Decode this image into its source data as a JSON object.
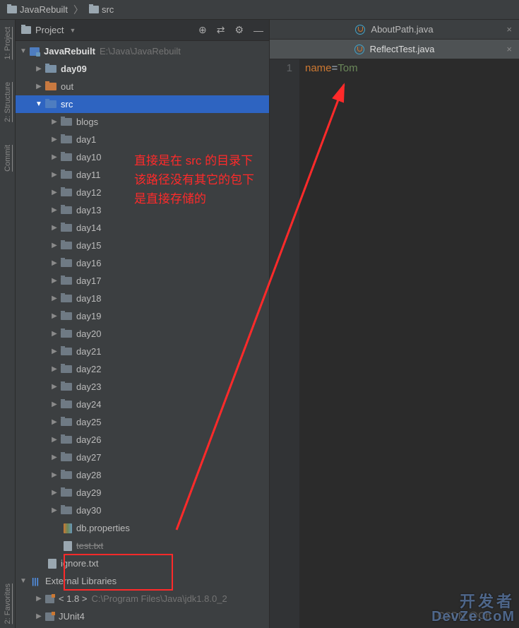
{
  "breadcrumb": {
    "items": [
      "JavaRebuilt",
      "src"
    ]
  },
  "panel": {
    "title": "Project",
    "actions": {
      "target": "⊕",
      "split": "⇄",
      "gear": "⚙",
      "hide": "—"
    }
  },
  "project": {
    "name": "JavaRebuilt",
    "path": "E:\\Java\\JavaRebuilt"
  },
  "tree": {
    "top": [
      {
        "label": "day09",
        "icon": "folder-blue",
        "indent": 2,
        "arrow": "right",
        "bold": true
      },
      {
        "label": "out",
        "icon": "folder-orange",
        "indent": 2,
        "arrow": "right"
      }
    ],
    "src": {
      "label": "src"
    },
    "dirs": [
      "blogs",
      "day1",
      "day10",
      "day11",
      "day12",
      "day13",
      "day14",
      "day15",
      "day16",
      "day17",
      "day18",
      "day19",
      "day20",
      "day21",
      "day22",
      "day23",
      "day24",
      "day25",
      "day26",
      "day27",
      "day28",
      "day29",
      "day30"
    ],
    "files": [
      {
        "label": "db.properties",
        "icon": "file-prop"
      },
      {
        "label": "test.txt",
        "icon": "file-plain",
        "strike": true
      }
    ],
    "rootFiles": [
      {
        "label": "ignore.txt",
        "icon": "file-plain"
      }
    ],
    "libs": {
      "header": "External Libraries",
      "items": [
        {
          "prefix": "< 1.8 >",
          "path": "C:\\Program Files\\Java\\jdk1.8.0_2"
        },
        {
          "prefix": "JUnit4",
          "path": ""
        }
      ]
    }
  },
  "tabs": [
    {
      "label": "AboutPath.java",
      "active": false
    },
    {
      "label": "ReflectTest.java",
      "active": true
    }
  ],
  "editor": {
    "lineNo": "1",
    "code": {
      "key": "name",
      "eq": "=",
      "val": "Tom"
    }
  },
  "annotation": {
    "line1": "直接是在 src 的目录下",
    "line2": "该路径没有其它的包下",
    "line3": "是直接存储的"
  },
  "rail": {
    "project": "1: Project",
    "structure": "2: Structure",
    "commit": "Commit",
    "favorites": "2: Favorites"
  },
  "watermark": {
    "cn": "开发者",
    "en": "DevZe.CoM",
    "csdn": "CSDN @Ch"
  }
}
